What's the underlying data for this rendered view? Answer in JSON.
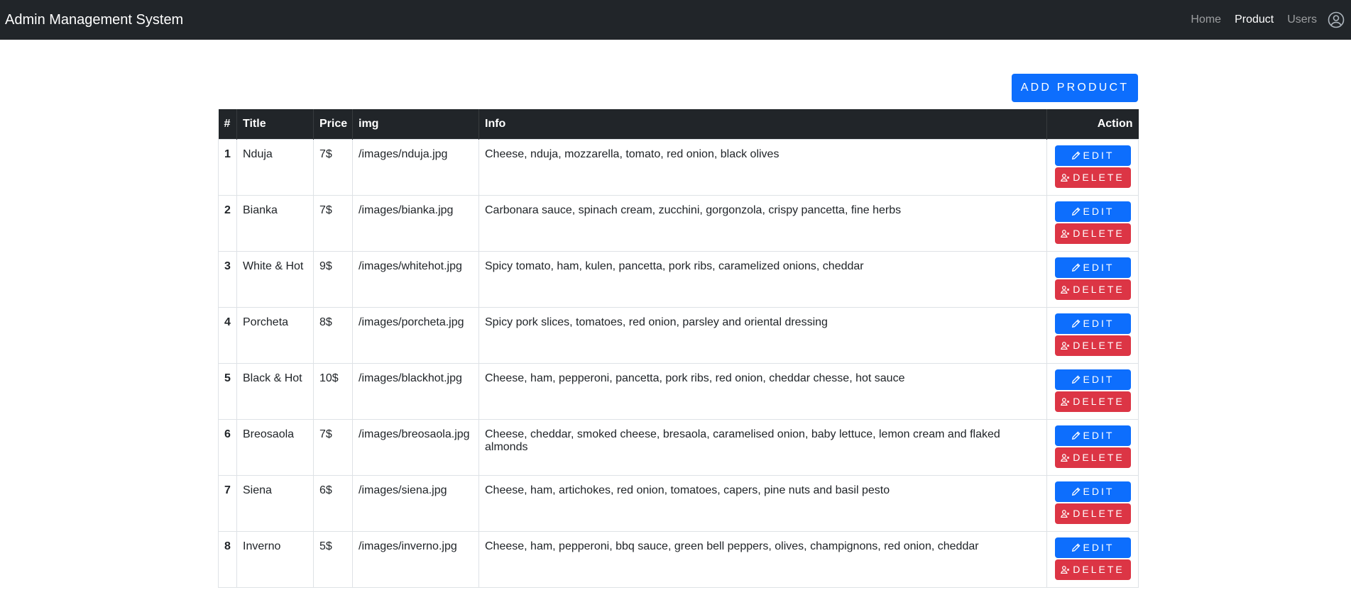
{
  "navbar": {
    "brand": "Admin Management System",
    "links": [
      "Home",
      "Product",
      "Users"
    ],
    "active": "Product"
  },
  "toolbar": {
    "add_label": "ADD PRODUCT"
  },
  "table": {
    "headers": [
      "#",
      "Title",
      "Price",
      "img",
      "Info",
      "Action"
    ],
    "rows": [
      {
        "num": "1",
        "title": "Nduja",
        "price": "7$",
        "img": "/images/nduja.jpg",
        "info": "Cheese, nduja, mozzarella, tomato, red onion, black olives"
      },
      {
        "num": "2",
        "title": "Bianka",
        "price": "7$",
        "img": "/images/bianka.jpg",
        "info": "Carbonara sauce, spinach cream, zucchini, gorgonzola, crispy pancetta, fine herbs"
      },
      {
        "num": "3",
        "title": "White & Hot",
        "price": "9$",
        "img": "/images/whitehot.jpg",
        "info": "Spicy tomato, ham, kulen, pancetta, pork ribs, caramelized onions, cheddar"
      },
      {
        "num": "4",
        "title": "Porcheta",
        "price": "8$",
        "img": "/images/porcheta.jpg",
        "info": "Spicy pork slices, tomatoes, red onion, parsley and oriental dressing"
      },
      {
        "num": "5",
        "title": "Black & Hot",
        "price": "10$",
        "img": "/images/blackhot.jpg",
        "info": "Cheese, ham, pepperoni, pancetta, pork ribs, red onion, cheddar chesse, hot sauce"
      },
      {
        "num": "6",
        "title": "Breosaola",
        "price": "7$",
        "img": "/images/breosaola.jpg",
        "info": "Cheese, cheddar, smoked cheese, bresaola, caramelised onion, baby lettuce, lemon cream and flaked almonds"
      },
      {
        "num": "7",
        "title": "Siena",
        "price": "6$",
        "img": "/images/siena.jpg",
        "info": "Cheese, ham, artichokes, red onion, tomatoes, capers, pine nuts and basil pesto"
      },
      {
        "num": "8",
        "title": "Inverno",
        "price": "5$",
        "img": "/images/inverno.jpg",
        "info": "Cheese, ham, pepperoni, bbq sauce, green bell peppers, olives, champignons, red onion, cheddar"
      }
    ],
    "edit_label": "EDIT",
    "delete_label": "DELETE"
  }
}
